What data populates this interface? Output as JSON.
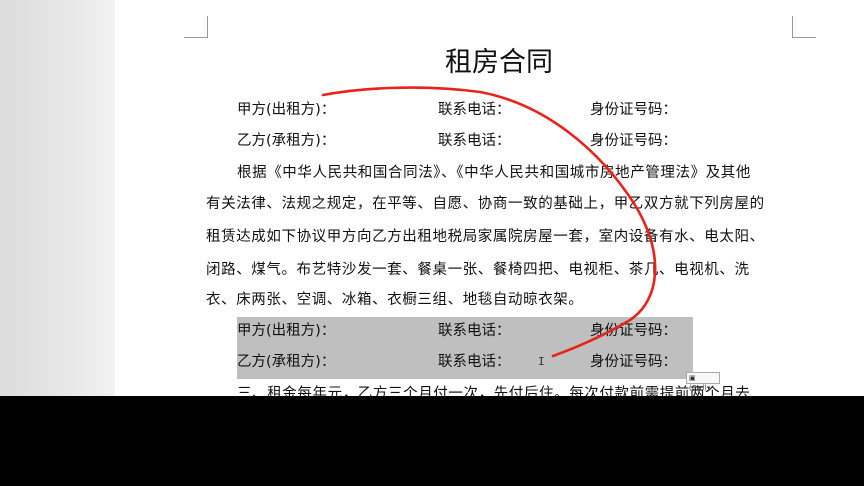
{
  "document": {
    "title": "租房合同",
    "party_rows": [
      {
        "lessor_label": "甲方(出租方)：",
        "phone_label": "联系电话：",
        "id_label": "身份证号码："
      },
      {
        "lessor_label": "乙方(承租方)：",
        "phone_label": "联系电话：",
        "id_label": "身份证号码："
      }
    ],
    "paragraph_lines": [
      "根据《中华人民共和国合同法》、《中华人民共和国城市房地产管理法》及其他",
      "有关法律、法规之规定，在平等、自愿、协商一致的基础上，甲乙双方就下列房屋的",
      "租赁达成如下协议甲方向乙方出租地税局家属院房屋一套，室内设备有水、电太阳、",
      "闭路、煤气。布艺特沙发一套、餐桌一张、餐椅四把、电视柜、茶几、电视机、洗",
      "衣、床两张、空调、冰箱、衣橱三组、地毯自动晾衣架。"
    ],
    "pasted_rows": [
      {
        "lessor_label": "甲方(出租方)：",
        "phone_label": "联系电话：",
        "id_label": "身份证号码："
      },
      {
        "lessor_label": "乙方(承租方)：",
        "phone_label": "联系电话：",
        "id_label": "身份证号码："
      }
    ],
    "clause_three": "三、租金每年元，乙方三个月付一次，先付后住。每次付款前需提前两个月去",
    "paste_options": "(Ctrl)▾",
    "annotation_color": "#e8231a",
    "highlight_color": "#bfbfbf"
  }
}
